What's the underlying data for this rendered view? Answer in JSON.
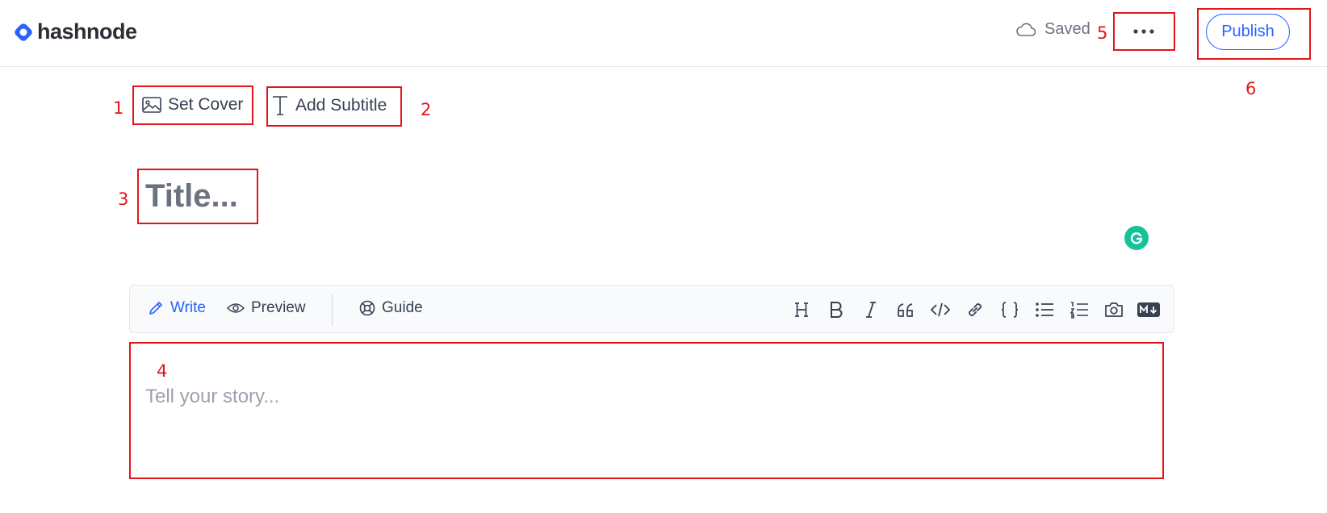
{
  "header": {
    "logo_text": "hashnode",
    "saved_label": "Saved",
    "publish_label": "Publish",
    "brand_color": "#2962ff"
  },
  "actions": {
    "set_cover": "Set Cover",
    "add_subtitle": "Add Subtitle"
  },
  "title": {
    "placeholder": "Title..."
  },
  "toolbar": {
    "tabs": [
      {
        "label": "Write",
        "icon": "pencil-icon",
        "active": true
      },
      {
        "label": "Preview",
        "icon": "eye-icon",
        "active": false
      },
      {
        "label": "Guide",
        "icon": "lifebuoy-icon",
        "active": false
      }
    ],
    "format_icons": [
      "heading-icon",
      "bold-icon",
      "italic-icon",
      "quote-icon",
      "code-icon",
      "link-icon",
      "code-block-icon",
      "bullet-list-icon",
      "numbered-list-icon",
      "camera-icon",
      "markdown-icon"
    ]
  },
  "editor": {
    "placeholder": "Tell your story..."
  },
  "annotations": {
    "markers": [
      "1",
      "2",
      "3",
      "4",
      "5",
      "6"
    ],
    "color": "#e0161b"
  }
}
